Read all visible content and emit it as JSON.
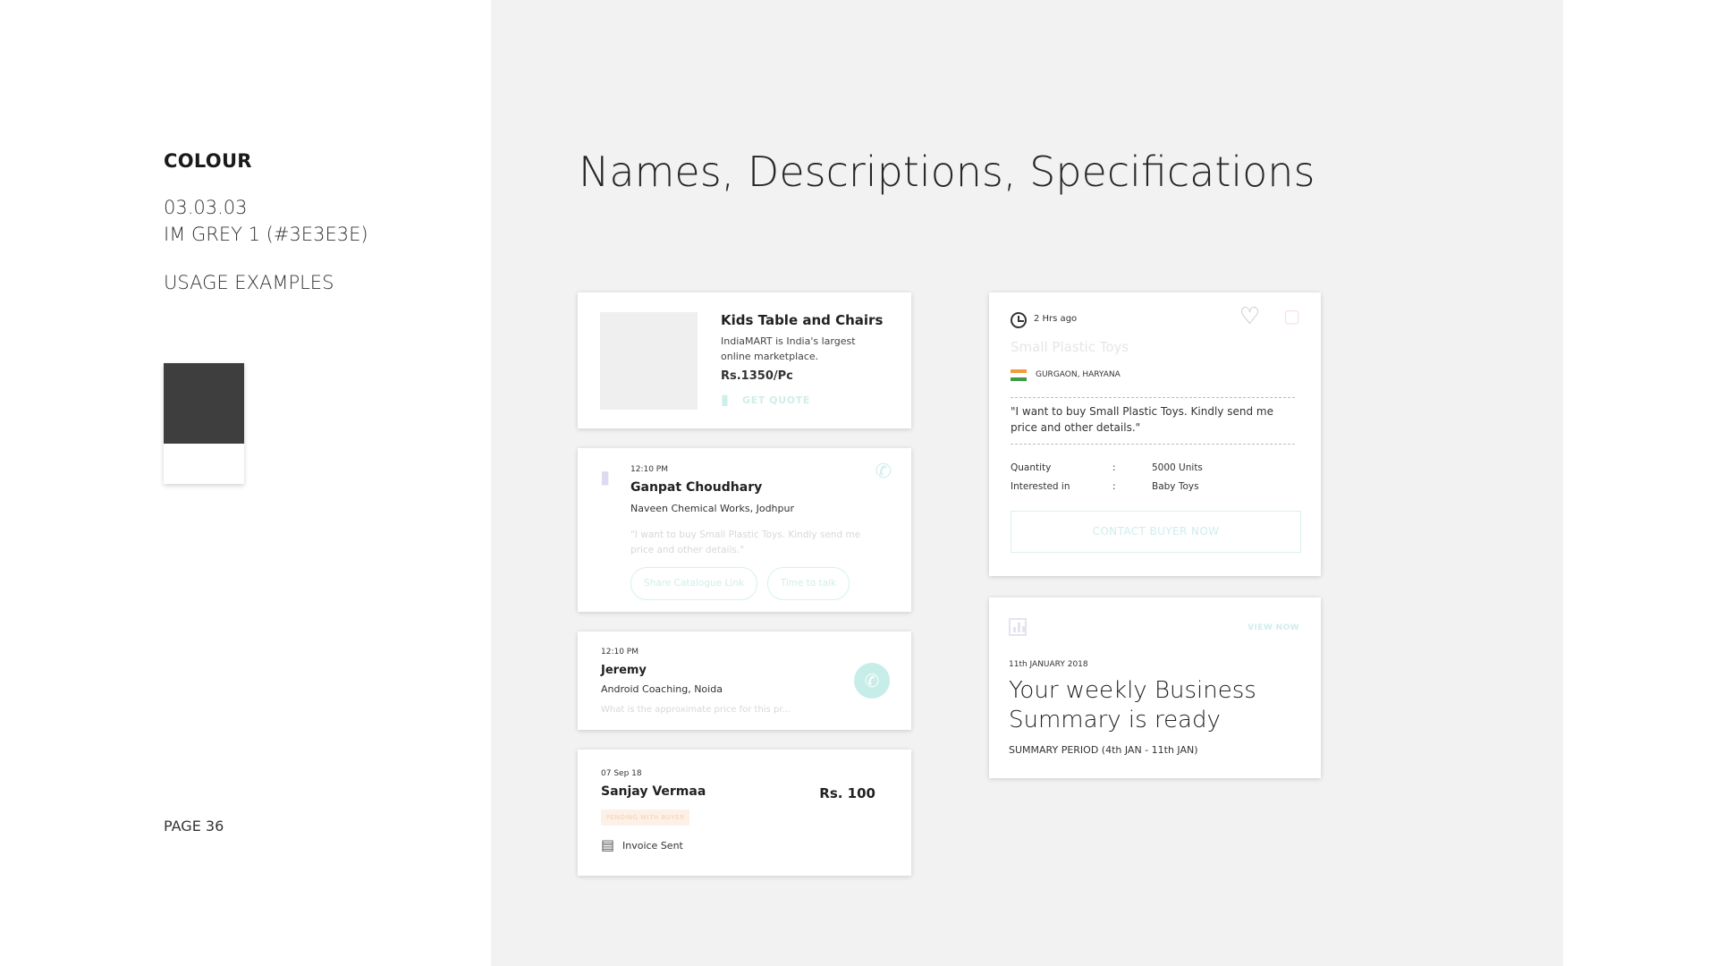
{
  "sidebar": {
    "section": "COLOUR",
    "code": "03.03.03",
    "color_name": "IM GREY 1 (#3E3E3E)",
    "usage": "USAGE EXAMPLES",
    "swatch_color": "#3e3e3e",
    "page": "PAGE 36"
  },
  "main": {
    "headline": "Names, Descriptions, Specifications"
  },
  "product_card": {
    "title": "Kids Table and Chairs",
    "description": "IndiaMART is India's largest online marketplace.",
    "price": "Rs.1350/Pc",
    "action": "GET QUOTE"
  },
  "enquiry_card": {
    "time": "12:10 PM",
    "name": "Ganpat Choudhary",
    "company": "Naveen Chemical Works, Jodhpur",
    "message": "\"I want to buy Small Plastic Toys. Kindly send me price and other details.\"",
    "action_1": "Share Catalogue Link",
    "action_2": "Time to talk"
  },
  "call_card": {
    "time": "12:10 PM",
    "name": "Jeremy",
    "company": "Android Coaching, Noida",
    "message": "What is the approximate price for this pr..."
  },
  "invoice_card": {
    "date": "07 Sep 18",
    "name": "Sanjay Vermaa",
    "amount": "Rs. 100",
    "status": "PENDING WITH BUYER",
    "note": "Invoice Sent"
  },
  "buylead_card": {
    "ago": "2 Hrs ago",
    "product": "Small Plastic Toys",
    "location": "GURGAON, HARYANA",
    "quote": "\"I want to buy Small Plastic Toys. Kindly send me price and other details.\"",
    "quantity_label": "Quantity",
    "quantity_value": "5000 Units",
    "interest_label": "Interested in",
    "interest_value": "Baby Toys",
    "separator": ":",
    "action": "CONTACT BUYER NOW"
  },
  "summary_card": {
    "view": "VIEW NOW",
    "date": "11th JANUARY 2018",
    "headline": "Your weekly Business Summary is ready",
    "period": "SUMMARY PERIOD (4th JAN - 11th JAN)"
  },
  "colors": {
    "accent_teal": "#c6ede7",
    "grey_1": "#3e3e3e",
    "panel_bg": "#f2f2f2"
  },
  "icons": [
    "chat-bubble-icon",
    "phone-icon",
    "clock-icon",
    "heart-icon",
    "trash-icon",
    "flag-india-icon",
    "invoice-icon",
    "bar-chart-icon"
  ]
}
